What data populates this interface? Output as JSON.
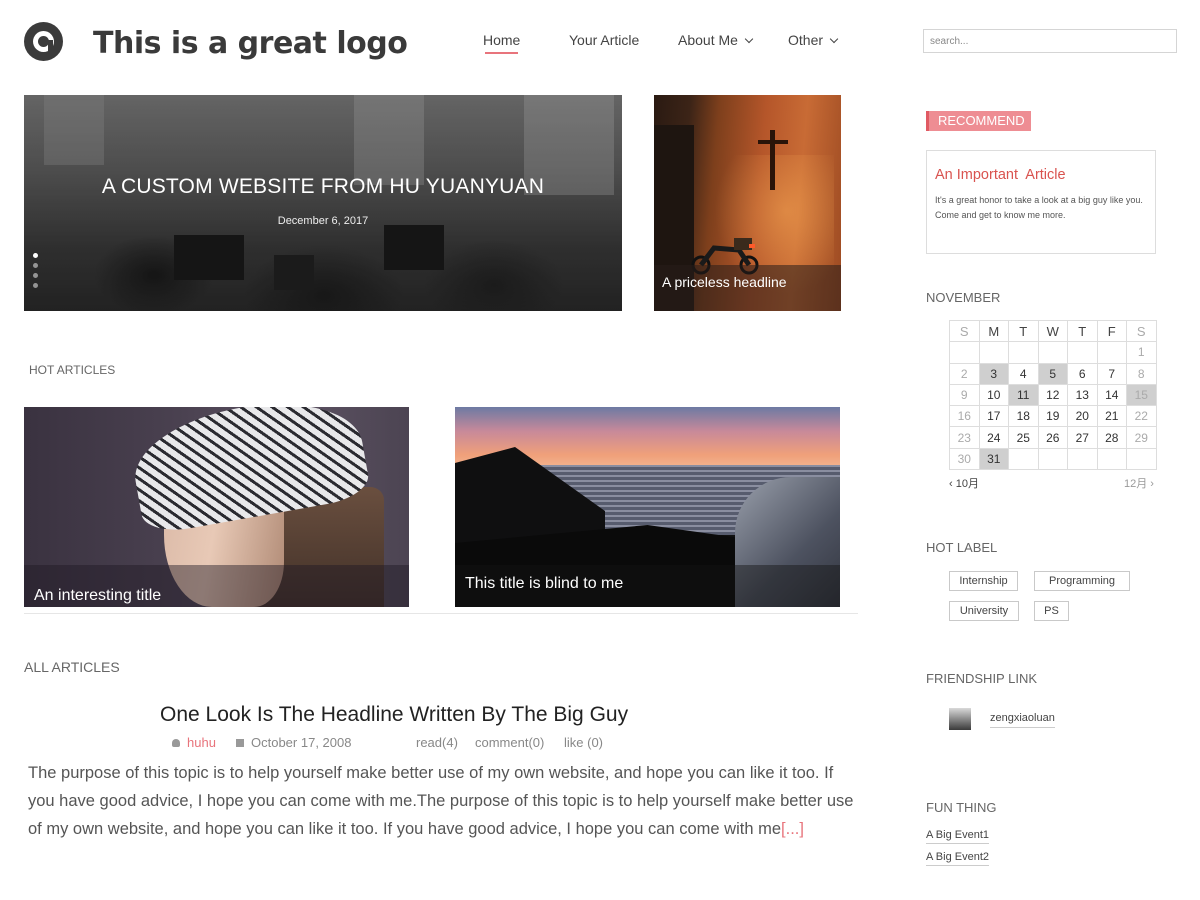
{
  "header": {
    "logo_text": "This is a great logo",
    "nav": [
      {
        "label": "Home",
        "active": true
      },
      {
        "label": "Your Article",
        "active": false
      },
      {
        "label": "About Me",
        "dropdown": true
      },
      {
        "label": "Other",
        "dropdown": true
      }
    ],
    "search_placeholder": "search..."
  },
  "hero": {
    "title": "A CUSTOM WEBSITE FROM HU YUANYUAN",
    "date": "December 6, 2017",
    "slide_count": 4,
    "active_slide": 1
  },
  "side_feature": {
    "caption": "A priceless headline"
  },
  "hot_articles": {
    "label": "HOT ARTICLES",
    "items": [
      {
        "title": "An interesting title"
      },
      {
        "title": "This title is blind to me"
      }
    ]
  },
  "all_articles": {
    "label": "ALL ARTICLES",
    "post": {
      "title": "One Look Is The Headline Written By The Big Guy",
      "author": "huhu",
      "date": "October 17, 2008",
      "read": "read(4)",
      "comment": "comment(0)",
      "like": "like (0)",
      "excerpt": "The purpose of this topic is to help yourself make better use of my own website, and hope you can like it too. If you have good advice, I hope you can come with me.The purpose of this topic is to help yourself make better use of my own website, and hope you can like it too. If you have good advice, I hope you can come with me",
      "more": "[...]"
    }
  },
  "sidebar": {
    "recommend": {
      "tag": "RECOMMEND",
      "title": "An Important  Article",
      "text": "It's a great honor to take a look at a big guy like you. Come and get to know me more."
    },
    "calendar": {
      "month": "NOVEMBER",
      "weekdays": [
        "S",
        "M",
        "T",
        "W",
        "T",
        "F",
        "S"
      ],
      "weeks": [
        [
          "",
          "",
          "",
          "",
          "",
          "",
          "1"
        ],
        [
          "2",
          "3",
          "4",
          "5",
          "6",
          "7",
          "8"
        ],
        [
          "9",
          "10",
          "11",
          "12",
          "13",
          "14",
          "15"
        ],
        [
          "16",
          "17",
          "18",
          "19",
          "20",
          "21",
          "22"
        ],
        [
          "23",
          "24",
          "25",
          "26",
          "27",
          "28",
          "29"
        ],
        [
          "30",
          "31",
          "",
          "",
          "",
          "",
          ""
        ]
      ],
      "highlighted": [
        "3",
        "5",
        "11",
        "15",
        "31"
      ],
      "prev": "10月",
      "next": "12月"
    },
    "hot_label": {
      "title": "HOT LABEL",
      "tags": [
        "Internship",
        "Programming",
        "University",
        "PS"
      ]
    },
    "friendship": {
      "title": "FRIENDSHIP LINK",
      "links": [
        "zengxiaoluan"
      ]
    },
    "fun_thing": {
      "title": "FUN THING",
      "items": [
        "A Big Event1",
        "A Big Event2"
      ]
    }
  },
  "colors": {
    "accent": "#e8747c",
    "recommend_bg": "#ee8d93",
    "rec_title": "#d9534f",
    "calendar_highlight": "#cfcfcf"
  }
}
